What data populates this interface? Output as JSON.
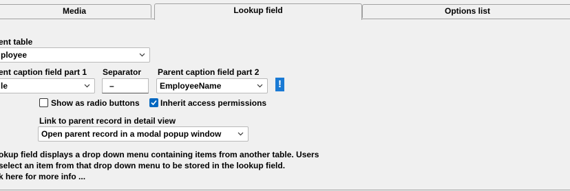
{
  "tabs": [
    {
      "label": "Media",
      "active": false
    },
    {
      "label": "Lookup field",
      "active": true
    },
    {
      "label": "Options list",
      "active": false
    }
  ],
  "form": {
    "parent_table_label": "ent table",
    "parent_table_value": "ployee",
    "caption1_label": "ent caption field part 1",
    "caption1_value": "le",
    "separator_label": "Separator",
    "separator_value": "–",
    "caption2_label": "Parent caption field part 2",
    "caption2_value": "EmployeeName",
    "help_icon": "exclamation-icon",
    "help_glyph": "!",
    "radio_checkbox_label": "Show as radio buttons",
    "radio_checkbox_checked": false,
    "inherit_checkbox_label": "Inherit access permissions",
    "inherit_checkbox_checked": true,
    "link_label": "Link to parent record in detail view",
    "link_value": "Open parent record in a modal popup window"
  },
  "info": {
    "line1": "okup field displays a drop down menu containing items from another table. Users",
    "line2": "select an item from that drop down menu to be stored in the lookup field.",
    "line3": "k here for more info ..."
  },
  "colors": {
    "accent": "#0067c0",
    "help_icon_bg": "#1a7ad4",
    "background": "#f0f0f0"
  }
}
